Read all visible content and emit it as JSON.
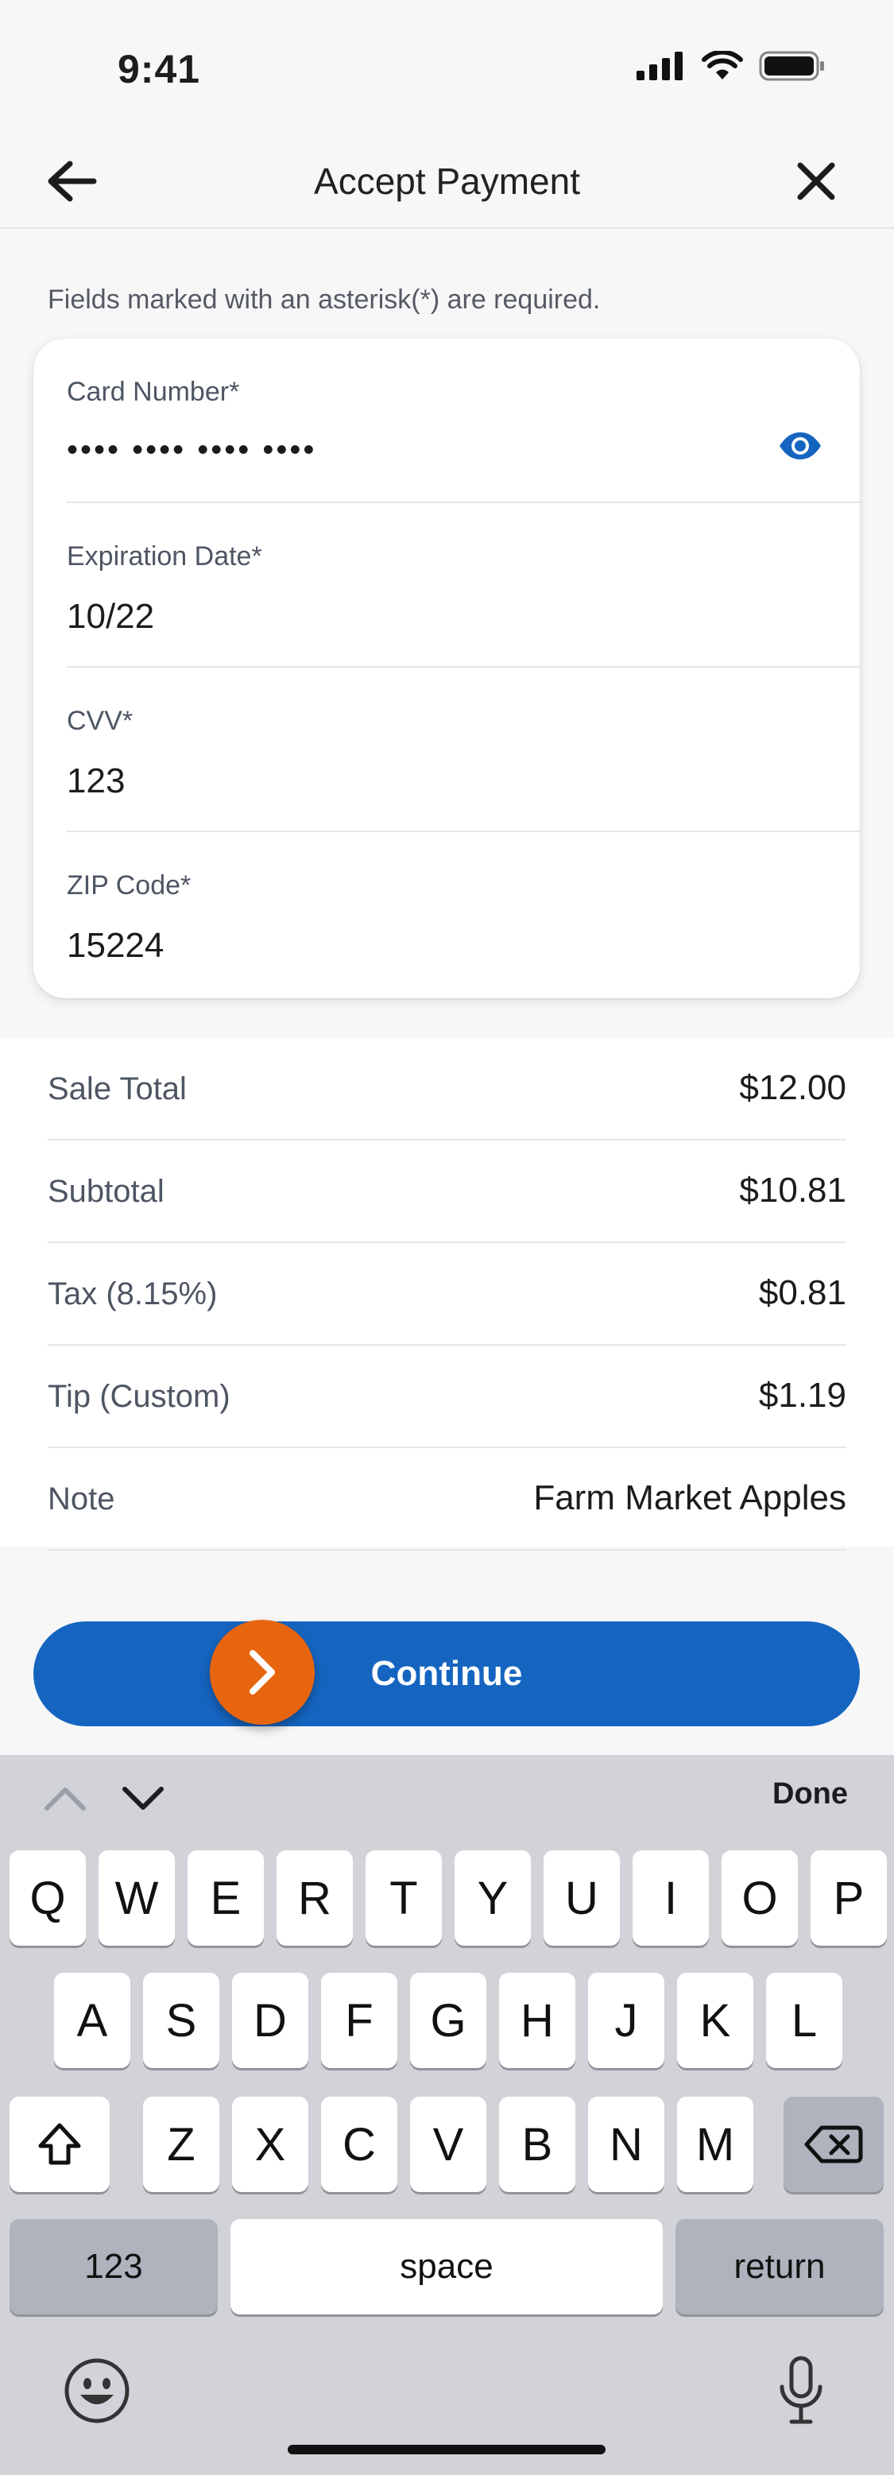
{
  "status_bar": {
    "time": "9:41"
  },
  "nav": {
    "title": "Accept Payment"
  },
  "form": {
    "required_note": "Fields marked with an asterisk(*) are required.",
    "fields": [
      {
        "label": "Card Number*",
        "value": "•••• •••• •••• ••••"
      },
      {
        "label": "Expiration Date*",
        "value": "10/22"
      },
      {
        "label": "CVV*",
        "value": "123"
      },
      {
        "label": "ZIP Code*",
        "value": "15224"
      }
    ]
  },
  "summary": [
    {
      "label": "Sale Total",
      "value": "$12.00"
    },
    {
      "label": "Subtotal",
      "value": "$10.81"
    },
    {
      "label": "Tax (8.15%)",
      "value": "$0.81"
    },
    {
      "label": "Tip (Custom)",
      "value": "$1.19"
    },
    {
      "label": "Note",
      "value": "Farm Market Apples"
    }
  ],
  "continue": {
    "label": "Continue"
  },
  "keyboard": {
    "done_label": "Done",
    "row1": [
      "Q",
      "W",
      "E",
      "R",
      "T",
      "Y",
      "U",
      "I",
      "O",
      "P"
    ],
    "row2": [
      "A",
      "S",
      "D",
      "F",
      "G",
      "H",
      "J",
      "K",
      "L"
    ],
    "row3": [
      "Z",
      "X",
      "C",
      "V",
      "B",
      "N",
      "M"
    ],
    "numbers_label": "123",
    "space_label": "space",
    "return_label": "return"
  },
  "colors": {
    "primary": "#1565c0",
    "accent": "#e8650f",
    "keyboard_bg": "#d1d3d9"
  }
}
